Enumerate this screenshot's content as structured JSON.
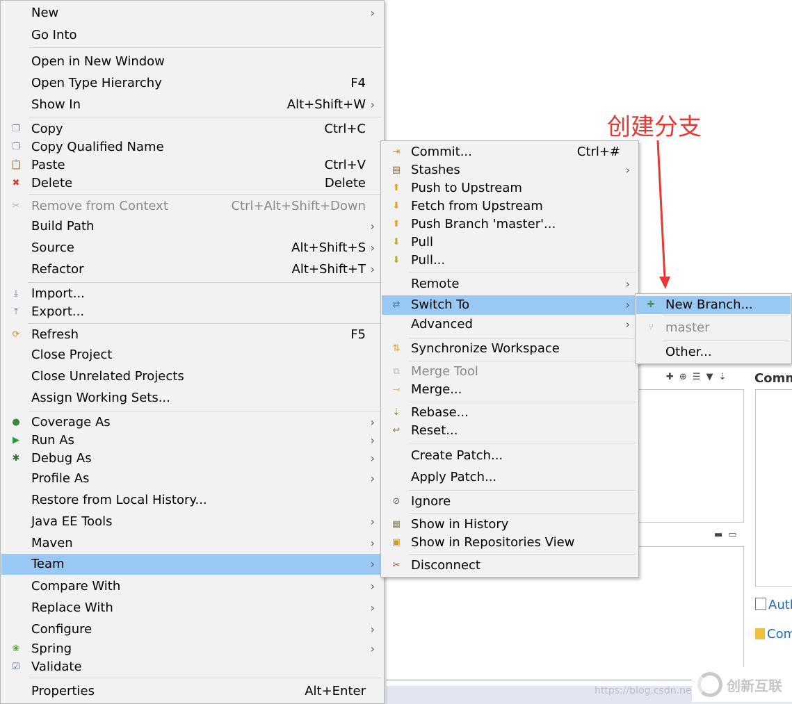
{
  "annotation": {
    "text": "创建分支",
    "color": "#e53935"
  },
  "main_menu": {
    "items": [
      {
        "label": "New",
        "shortcut": "",
        "submenu": true,
        "icon": ""
      },
      {
        "label": "Go Into",
        "shortcut": "",
        "submenu": false,
        "icon": ""
      },
      {
        "label": "Open in New Window",
        "shortcut": "",
        "submenu": false,
        "icon": ""
      },
      {
        "label": "Open Type Hierarchy",
        "shortcut": "F4",
        "submenu": false,
        "icon": ""
      },
      {
        "label": "Show In",
        "shortcut": "Alt+Shift+W",
        "submenu": true,
        "icon": ""
      },
      {
        "label": "Copy",
        "shortcut": "Ctrl+C",
        "submenu": false,
        "icon": "copy-icon"
      },
      {
        "label": "Copy Qualified Name",
        "shortcut": "",
        "submenu": false,
        "icon": "copy-qualified-name-icon"
      },
      {
        "label": "Paste",
        "shortcut": "Ctrl+V",
        "submenu": false,
        "icon": "paste-icon"
      },
      {
        "label": "Delete",
        "shortcut": "Delete",
        "submenu": false,
        "icon": "delete-icon"
      },
      {
        "label": "Remove from Context",
        "shortcut": "Ctrl+Alt+Shift+Down",
        "submenu": false,
        "icon": "remove-context-icon",
        "disabled": true
      },
      {
        "label": "Build Path",
        "shortcut": "",
        "submenu": true,
        "icon": ""
      },
      {
        "label": "Source",
        "shortcut": "Alt+Shift+S",
        "submenu": true,
        "icon": ""
      },
      {
        "label": "Refactor",
        "shortcut": "Alt+Shift+T",
        "submenu": true,
        "icon": ""
      },
      {
        "label": "Import...",
        "shortcut": "",
        "submenu": false,
        "icon": "import-icon"
      },
      {
        "label": "Export...",
        "shortcut": "",
        "submenu": false,
        "icon": "export-icon"
      },
      {
        "label": "Refresh",
        "shortcut": "F5",
        "submenu": false,
        "icon": "refresh-icon"
      },
      {
        "label": "Close Project",
        "shortcut": "",
        "submenu": false,
        "icon": ""
      },
      {
        "label": "Close Unrelated Projects",
        "shortcut": "",
        "submenu": false,
        "icon": ""
      },
      {
        "label": "Assign Working Sets...",
        "shortcut": "",
        "submenu": false,
        "icon": ""
      },
      {
        "label": "Coverage As",
        "shortcut": "",
        "submenu": true,
        "icon": "coverage-icon"
      },
      {
        "label": "Run As",
        "shortcut": "",
        "submenu": true,
        "icon": "run-icon"
      },
      {
        "label": "Debug As",
        "shortcut": "",
        "submenu": true,
        "icon": "debug-icon"
      },
      {
        "label": "Profile As",
        "shortcut": "",
        "submenu": true,
        "icon": ""
      },
      {
        "label": "Restore from Local History...",
        "shortcut": "",
        "submenu": false,
        "icon": ""
      },
      {
        "label": "Java EE Tools",
        "shortcut": "",
        "submenu": true,
        "icon": ""
      },
      {
        "label": "Maven",
        "shortcut": "",
        "submenu": true,
        "icon": ""
      },
      {
        "label": "Team",
        "shortcut": "",
        "submenu": true,
        "icon": "",
        "selected": true
      },
      {
        "label": "Compare With",
        "shortcut": "",
        "submenu": true,
        "icon": ""
      },
      {
        "label": "Replace With",
        "shortcut": "",
        "submenu": true,
        "icon": ""
      },
      {
        "label": "Configure",
        "shortcut": "",
        "submenu": true,
        "icon": ""
      },
      {
        "label": "Spring",
        "shortcut": "",
        "submenu": true,
        "icon": "spring-icon"
      },
      {
        "label": "Validate",
        "shortcut": "",
        "submenu": false,
        "icon": "validate-icon"
      },
      {
        "label": "Properties",
        "shortcut": "Alt+Enter",
        "submenu": false,
        "icon": ""
      }
    ]
  },
  "team_menu": {
    "items": [
      {
        "label": "Commit...",
        "shortcut": "Ctrl+#",
        "submenu": false,
        "icon": "commit-icon"
      },
      {
        "label": "Stashes",
        "shortcut": "",
        "submenu": true,
        "icon": "stashes-icon"
      },
      {
        "label": "Push to Upstream",
        "shortcut": "",
        "submenu": false,
        "icon": "push-icon"
      },
      {
        "label": "Fetch from Upstream",
        "shortcut": "",
        "submenu": false,
        "icon": "fetch-icon"
      },
      {
        "label": "Push Branch 'master'...",
        "shortcut": "",
        "submenu": false,
        "icon": "push-branch-icon"
      },
      {
        "label": "Pull",
        "shortcut": "",
        "submenu": false,
        "icon": "pull-icon"
      },
      {
        "label": "Pull...",
        "shortcut": "",
        "submenu": false,
        "icon": "pull-dialog-icon"
      },
      {
        "label": "Remote",
        "shortcut": "",
        "submenu": true,
        "icon": ""
      },
      {
        "label": "Switch To",
        "shortcut": "",
        "submenu": true,
        "icon": "switch-to-icon",
        "selected": true
      },
      {
        "label": "Advanced",
        "shortcut": "",
        "submenu": true,
        "icon": ""
      },
      {
        "label": "Synchronize Workspace",
        "shortcut": "",
        "submenu": false,
        "icon": "synchronize-icon"
      },
      {
        "label": "Merge Tool",
        "shortcut": "",
        "submenu": false,
        "icon": "merge-tool-icon",
        "disabled": true
      },
      {
        "label": "Merge...",
        "shortcut": "",
        "submenu": false,
        "icon": "merge-icon"
      },
      {
        "label": "Rebase...",
        "shortcut": "",
        "submenu": false,
        "icon": "rebase-icon"
      },
      {
        "label": "Reset...",
        "shortcut": "",
        "submenu": false,
        "icon": "reset-icon"
      },
      {
        "label": "Create Patch...",
        "shortcut": "",
        "submenu": false,
        "icon": ""
      },
      {
        "label": "Apply Patch...",
        "shortcut": "",
        "submenu": false,
        "icon": ""
      },
      {
        "label": "Ignore",
        "shortcut": "",
        "submenu": false,
        "icon": "ignore-icon"
      },
      {
        "label": "Show in History",
        "shortcut": "",
        "submenu": false,
        "icon": "history-icon"
      },
      {
        "label": "Show in Repositories View",
        "shortcut": "",
        "submenu": false,
        "icon": "repositories-icon"
      },
      {
        "label": "Disconnect",
        "shortcut": "",
        "submenu": false,
        "icon": "disconnect-icon"
      }
    ]
  },
  "switch_menu": {
    "items": [
      {
        "label": "New Branch...",
        "icon": "new-branch-icon",
        "selected": true
      },
      {
        "label": "master",
        "icon": "branch-icon",
        "disabled": true
      },
      {
        "label": "Other...",
        "icon": ""
      }
    ]
  },
  "background": {
    "panel_title": "Comm",
    "links": [
      "Auth",
      "Com"
    ],
    "watermark_url": "https://blog.csdn.ne",
    "watermark_logo": "创新互联"
  }
}
